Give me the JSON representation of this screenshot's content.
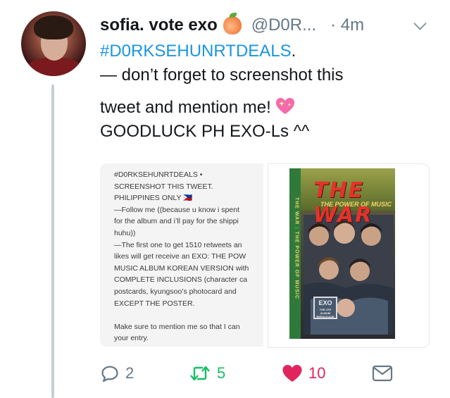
{
  "tweet": {
    "display_name": "sofia. vote exo",
    "handle": "@D0R...",
    "time": "· 4m",
    "hashtag": "#D0RKSEHUNRTDEALS",
    "hashtag_suffix": ".",
    "line2": "— don’t forget to screenshot this",
    "line3": "tweet and mention me!",
    "line4": "GOODLUCK PH EXO-Ls ^^"
  },
  "media": {
    "screenshot_text": "#D0RKSEHUNRTDEALS •\nSCREENSHOT THIS TWEET.\nPHILIPPINES ONLY 🇵🇭\n—Follow me ((because u know i spent\nfor the album and i’ll pay for the shippi\nhuhu))\n—The first one to get 1510 retweets an\nlikes will get receive an EXO: THE POW\nMUSIC ALBUM KOREAN VERSION with\nCOMPLETE INCLUSIONS (character ca\npostcards, kyungsoo’s photocard and \nEXCEPT THE POSTER.\n\nMake sure to mention me so that I can\nyour entry.",
    "album_title": "THE WAR",
    "album_subtitle": "THE POWER OF MUSIC",
    "album_spine": "THE WAR : THE POWER OF MUSIC",
    "album_logo": "EXO",
    "album_logo_small": "THE 4TH ALBUM REPACKAGE"
  },
  "actions": {
    "reply_count": "2",
    "retweet_count": "5",
    "like_count": "10"
  },
  "icons": {
    "peach": "peach-icon",
    "heart_emoji": "sparkling-heart-icon",
    "reply": "reply-icon",
    "retweet": "retweet-icon",
    "like": "like-icon",
    "dm": "direct-message-icon",
    "chevron": "chevron-down-icon"
  },
  "colors": {
    "link": "#1b95e0",
    "retweet": "#17bf63",
    "like": "#e0245e",
    "muted": "#657786"
  }
}
